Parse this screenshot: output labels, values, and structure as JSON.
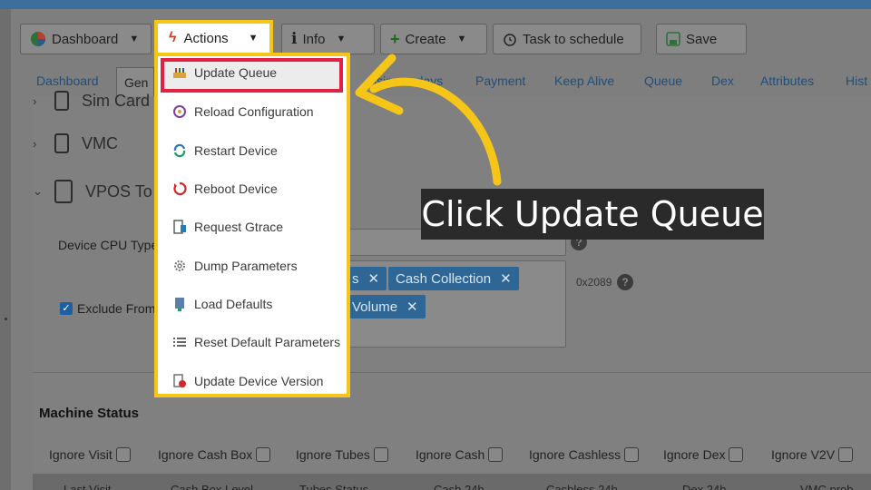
{
  "toolbar": {
    "dashboard": "Dashboard",
    "actions": "Actions",
    "info": "Info",
    "create": "Create",
    "schedule": "Task to schedule",
    "save": "Save"
  },
  "tabs": [
    "Dashboard",
    "Gen",
    "isiness days",
    "Payment",
    "Keep Alive",
    "Queue",
    "Dex",
    "Attributes",
    "Hist"
  ],
  "accordion": {
    "sim_card": "Sim Card",
    "vmc": "VMC",
    "vpos": "VPOS To"
  },
  "form": {
    "cpu_label": "Device CPU Type",
    "exclude_label": "Exclude From",
    "chips": [
      "s",
      "Cash Collection",
      "Volume"
    ],
    "hex_value": "0x2089"
  },
  "machine_status": {
    "title": "Machine Status",
    "ignore": [
      "Ignore Visit",
      "Ignore Cash Box",
      "Ignore Tubes",
      "Ignore Cash",
      "Ignore Cashless",
      "Ignore Dex",
      "Ignore V2V"
    ],
    "columns": [
      "Last Visit",
      "Cash Box Level",
      "Tubes Status",
      "Cash 24h",
      "Cashless 24h",
      "Dex 24h",
      "VMC prob"
    ]
  },
  "actions_menu": {
    "items": [
      {
        "label": "Update Queue",
        "icon": "queue-icon"
      },
      {
        "label": "Reload Configuration",
        "icon": "reload-config-icon"
      },
      {
        "label": "Restart Device",
        "icon": "restart-icon"
      },
      {
        "label": "Reboot Device",
        "icon": "reboot-icon"
      },
      {
        "label": "Request Gtrace",
        "icon": "gtrace-icon"
      },
      {
        "label": "Dump Parameters",
        "icon": "gear-icon"
      },
      {
        "label": "Load Defaults",
        "icon": "load-defaults-icon"
      },
      {
        "label": "Reset Default Parameters",
        "icon": "list-icon"
      },
      {
        "label": "Update Device Version",
        "icon": "device-version-icon"
      }
    ]
  },
  "callout": "Click Update Queue",
  "colors": {
    "highlight_yellow": "#f5c518",
    "highlight_red": "#e0213f",
    "chip_blue": "#2e6795"
  }
}
